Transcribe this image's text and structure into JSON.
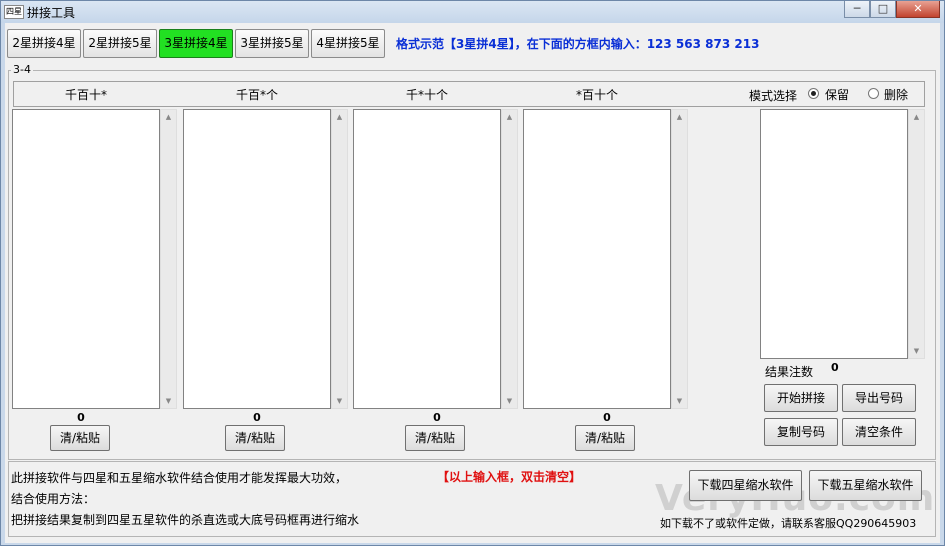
{
  "window": {
    "icon_text": "四星",
    "title": "拼接工具",
    "min_label": "─",
    "max_label": "□",
    "close_label": "✕"
  },
  "tabs": [
    {
      "label": "2星拼接4星",
      "active": false
    },
    {
      "label": "2星拼接5星",
      "active": false
    },
    {
      "label": "3星拼接4星",
      "active": true
    },
    {
      "label": "3星拼接5星",
      "active": false
    },
    {
      "label": "4星拼接5星",
      "active": false
    }
  ],
  "format_hint": "格式示范【3星拼4星】，在下面的方框内输入：123 563 873 213",
  "group_label": "3-4",
  "columns": [
    {
      "title": "千百十*",
      "count": "0",
      "clear_label": "清/粘贴"
    },
    {
      "title": "千百*个",
      "count": "0",
      "clear_label": "清/粘贴"
    },
    {
      "title": "千*十个",
      "count": "0",
      "clear_label": "清/粘贴"
    },
    {
      "title": "*百十个",
      "count": "0",
      "clear_label": "清/粘贴"
    }
  ],
  "mode": {
    "label": "模式选择",
    "options": [
      "保留",
      "删除"
    ],
    "selected": "保留"
  },
  "result": {
    "count_label": "结果注数",
    "count": "0"
  },
  "actions": {
    "start": "开始拼接",
    "export": "导出号码",
    "copy": "复制号码",
    "clear": "清空条件"
  },
  "bottom": {
    "line1": "此拼接软件与四星和五星缩水软件结合使用才能发挥最大功效，",
    "line2": "结合使用方法：",
    "line3": "把拼接结果复制到四星五星软件的杀直选或大底号码框再进行缩水",
    "red_hint": "【以上输入框，双击清空】",
    "download4": "下载四星缩水软件",
    "download5": "下载五星缩水软件",
    "contact": "如下载不了或软件定做，请联系客服QQ290645903"
  },
  "watermark": "VeryHuo.com"
}
